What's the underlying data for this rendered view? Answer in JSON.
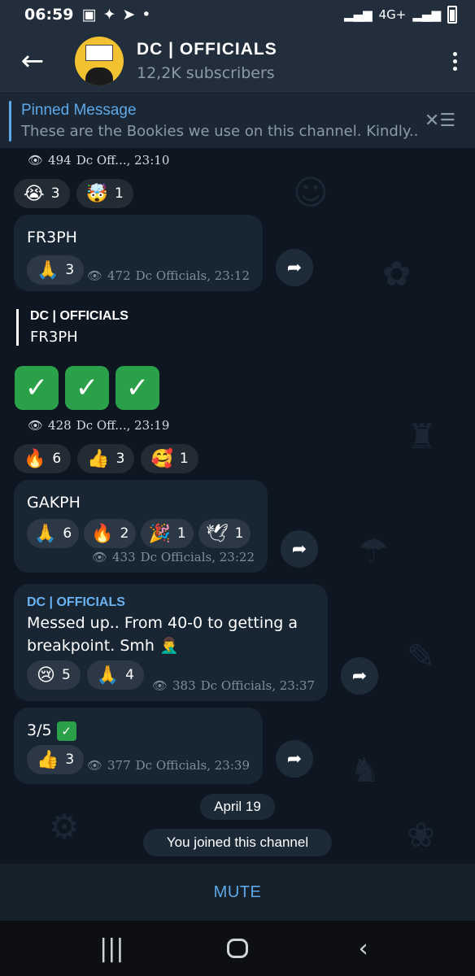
{
  "status_bar": {
    "time": "06:59",
    "network": "4G+"
  },
  "header": {
    "title": "DC | OFFICIALS",
    "subtitle": "12,2K subscribers"
  },
  "pinned": {
    "title": "Pinned Message",
    "text": "These are the Bookies we use on this channel. Kindly..."
  },
  "messages": {
    "m0": {
      "views": "494",
      "author_time": "Dc Off..., 23:10",
      "reactions": [
        {
          "emoji": "😭",
          "count": "3"
        },
        {
          "emoji": "🤯",
          "count": "1"
        }
      ]
    },
    "m1": {
      "text": "FR3PH",
      "views": "472",
      "author_time": "Dc Officials, 23:12",
      "reactions": [
        {
          "emoji": "🙏",
          "count": "3"
        }
      ]
    },
    "m2": {
      "reply_sender": "DC | OFFICIALS",
      "reply_text": "FR3PH",
      "checks": "✓✓✓",
      "views": "428",
      "author_time": "Dc Off..., 23:19",
      "reactions": [
        {
          "emoji": "🔥",
          "count": "6"
        },
        {
          "emoji": "👍",
          "count": "3"
        },
        {
          "emoji": "🥰",
          "count": "1"
        }
      ]
    },
    "m3": {
      "text": "GAKPH",
      "views": "433",
      "author_time": "Dc Officials, 23:22",
      "reactions": [
        {
          "emoji": "🙏",
          "count": "6"
        },
        {
          "emoji": "🔥",
          "count": "2"
        },
        {
          "emoji": "🎉",
          "count": "1"
        },
        {
          "emoji": "🕊",
          "count": "1"
        }
      ]
    },
    "m4": {
      "sender": "DC | OFFICIALS",
      "text": "Messed up.. From 40-0 to getting a breakpoint. Smh 🤦‍♂️",
      "views": "383",
      "author_time": "Dc Officials, 23:37",
      "reactions": [
        {
          "emoji": "😢",
          "count": "5"
        },
        {
          "emoji": "🙏",
          "count": "4"
        }
      ]
    },
    "m5": {
      "text": "3/5",
      "views": "377",
      "author_time": "Dc Officials, 23:39",
      "reactions": [
        {
          "emoji": "👍",
          "count": "3"
        }
      ]
    }
  },
  "date_label": "April 19",
  "service_text": "You joined this channel",
  "mute_label": "MUTE",
  "colors": {
    "accent": "#5fa8e8",
    "bubble": "#182533",
    "header": "#222e3b",
    "background": "#0e1621"
  }
}
